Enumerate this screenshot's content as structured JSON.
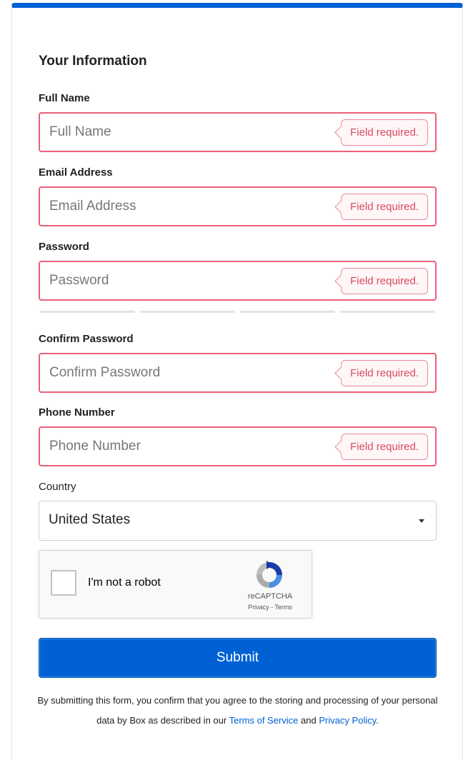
{
  "form": {
    "section_title": "Your Information",
    "fields": {
      "full_name": {
        "label": "Full Name",
        "placeholder": "Full Name",
        "error": "Field required."
      },
      "email": {
        "label": "Email Address",
        "placeholder": "Email Address",
        "error": "Field required."
      },
      "password": {
        "label": "Password",
        "placeholder": "Password",
        "error": "Field required."
      },
      "confirm_password": {
        "label": "Confirm Password",
        "placeholder": "Confirm Password",
        "error": "Field required."
      },
      "phone": {
        "label": "Phone Number",
        "placeholder": "Phone Number",
        "error": "Field required."
      }
    },
    "country": {
      "label": "Country",
      "selected": "United States"
    },
    "captcha": {
      "text": "I'm not a robot",
      "brand": "reCAPTCHA",
      "links": "Privacy - Terms"
    },
    "submit_label": "Submit",
    "disclaimer": {
      "text_before": "By submitting this form, you confirm that you agree to the storing and processing of your personal data by Box as described in our ",
      "terms_link": "Terms of Service",
      "text_and": " and ",
      "privacy_link": "Privacy Policy",
      "text_after": "."
    }
  },
  "colors": {
    "accent": "#0061d5",
    "error_border": "#ec6079",
    "error_text": "#d74a62"
  }
}
